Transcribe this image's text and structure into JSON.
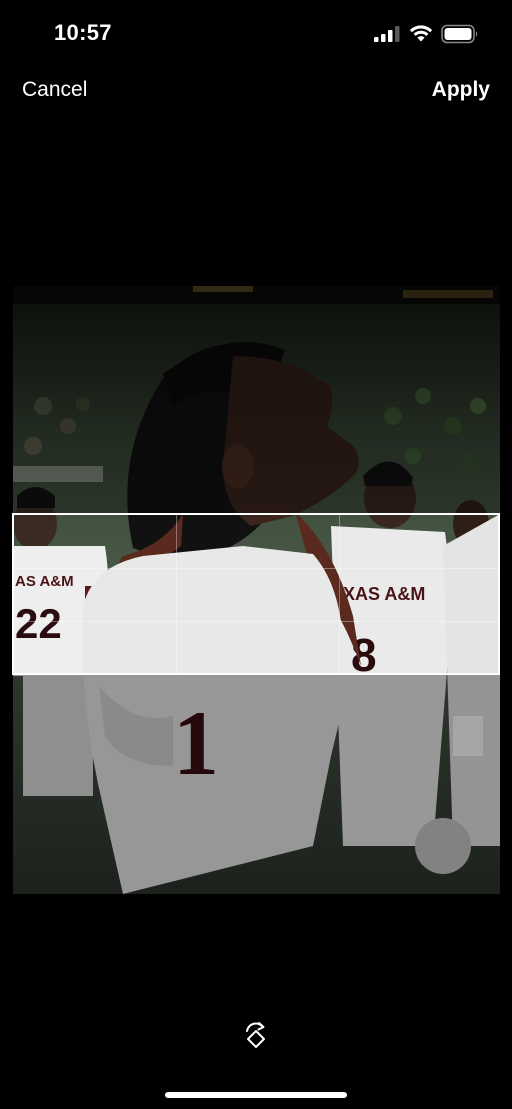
{
  "status_bar": {
    "time": "10:57"
  },
  "nav": {
    "cancel_label": "Cancel",
    "apply_label": "Apply"
  },
  "photo": {
    "jersey_number_main": "1",
    "jersey_text_left": "AS A&M",
    "jersey_number_left": "22",
    "jersey_text_right": "XAS A&M",
    "jersey_number_right": "8"
  },
  "icons": {
    "signal": "cellular-signal-icon",
    "wifi": "wifi-icon",
    "battery": "battery-icon",
    "rotate": "rotate-icon"
  },
  "colors": {
    "background": "#000000",
    "text": "#ffffff",
    "maroon": "#4a1416"
  }
}
